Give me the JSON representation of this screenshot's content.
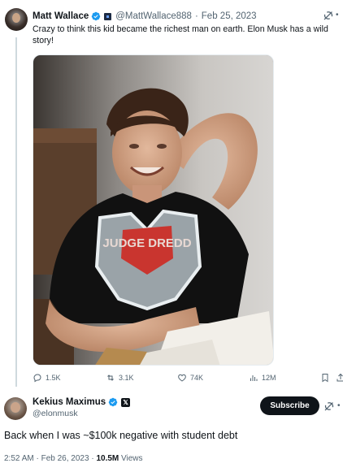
{
  "parent_tweet": {
    "author_name": "Matt Wallace",
    "handle": "@MattWallace888",
    "separator": "·",
    "date": "Feb 25, 2023",
    "text": "Crazy to think this kid became the richest man on earth. Elon Musk has a wild story!",
    "photo_shirt_text": "JUDGE DREDD",
    "actions": {
      "replies": "1.5K",
      "reposts": "3.1K",
      "likes": "74K",
      "views": "12M"
    }
  },
  "main_tweet": {
    "author_name": "Kekius Maximus",
    "handle": "@elonmusk",
    "subscribe_label": "Subscribe",
    "text": "Back when I was ~$100k negative with student debt",
    "time": "2:52 AM",
    "separator": "·",
    "date": "Feb 26, 2023",
    "separator2": "·",
    "views_count": "10.5M",
    "views_label": "Views"
  },
  "colors": {
    "verified": "#1d9bf0",
    "muted_text": "#536471",
    "primary_text": "#0f1419"
  },
  "icons": [
    "verified-badge-icon",
    "grok-icon",
    "more-icon",
    "reply-icon",
    "repost-icon",
    "like-icon",
    "views-icon",
    "bookmark-icon",
    "x-affiliate-icon"
  ]
}
